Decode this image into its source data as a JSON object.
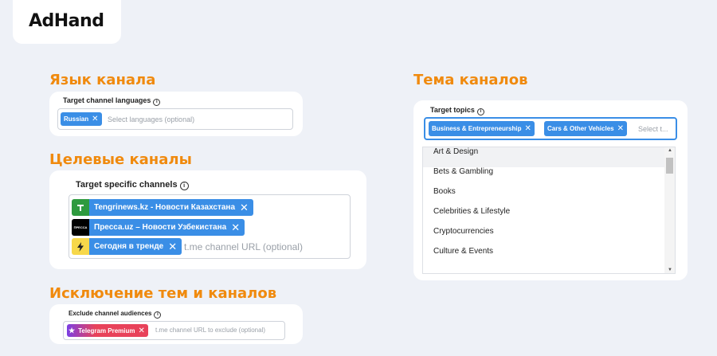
{
  "logo": "AdHand",
  "sections": {
    "language": {
      "heading": "Язык канала",
      "label": "Target channel languages",
      "chip": "Russian",
      "placeholder": "Select languages (optional)"
    },
    "channels": {
      "heading": "Целевые каналы",
      "label": "Target specific channels",
      "items": [
        {
          "name": "Tengrinews.kz - Новости Казахстана",
          "icon": "tengrinews-logo",
          "icon_color": "#2e9a3e"
        },
        {
          "name": "Пресса.uz – Новости Узбекистана",
          "icon": "pressa-logo",
          "icon_text": "ПРЕССА",
          "icon_color": "#000000"
        },
        {
          "name": "Сегодня в тренде",
          "icon": "lightning-icon",
          "icon_color": "#f7d84a"
        }
      ],
      "placeholder": "t.me channel URL (optional)"
    },
    "exclude": {
      "heading": "Исключение тем и каналов",
      "label": "Exclude channel audiences",
      "chip": "Telegram Premium",
      "placeholder": "t.me channel URL to exclude (optional)"
    },
    "topics": {
      "heading": "Тема каналов",
      "label": "Target topics",
      "chips": [
        "Business & Entrepreneurship",
        "Cars & Other Vehicles"
      ],
      "placeholder": "Select t...",
      "options": [
        "Art & Design",
        "Bets & Gambling",
        "Books",
        "Celebrities & Lifestyle",
        "Cryptocurrencies",
        "Culture & Events"
      ],
      "highlighted_option": "Art & Design"
    }
  },
  "colors": {
    "accent": "#3a8ee6",
    "heading": "#f08a0e",
    "background": "#eef1f7"
  },
  "info_glyph": "i",
  "close_glyph": "✕"
}
